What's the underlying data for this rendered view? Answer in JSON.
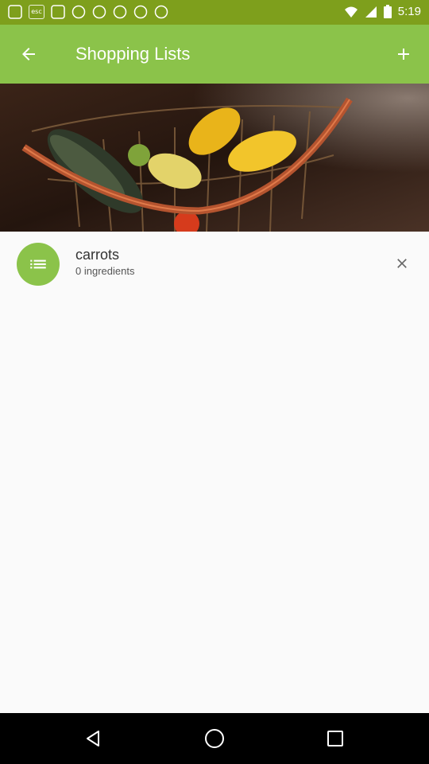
{
  "status_bar": {
    "time": "5:19",
    "left_icons": [
      "notification-app-icon",
      "esc-icon",
      "notification-app-icon",
      "notification-app-icon",
      "notification-app-icon",
      "notification-app-icon",
      "notification-app-icon",
      "notification-app-icon"
    ],
    "esc_label": "esc",
    "right_icons": [
      "wifi-icon",
      "signal-icon",
      "battery-icon"
    ]
  },
  "toolbar": {
    "title": "Shopping Lists",
    "back_icon": "arrow-back-icon",
    "add_icon": "plus-icon",
    "background": "#8bc34a"
  },
  "hero_image": {
    "description_icon": "vegetable-basket-image"
  },
  "lists": [
    {
      "name": "carrots",
      "subtitle": "0 ingredients",
      "icon": "list-icon",
      "action_icon": "close-icon"
    }
  ],
  "nav_bar": {
    "buttons": [
      "back-triangle-icon",
      "home-circle-icon",
      "recents-square-icon"
    ]
  },
  "colors": {
    "status_bar": "#7e9f1c",
    "accent": "#8bc34a",
    "background": "#fafafa"
  }
}
